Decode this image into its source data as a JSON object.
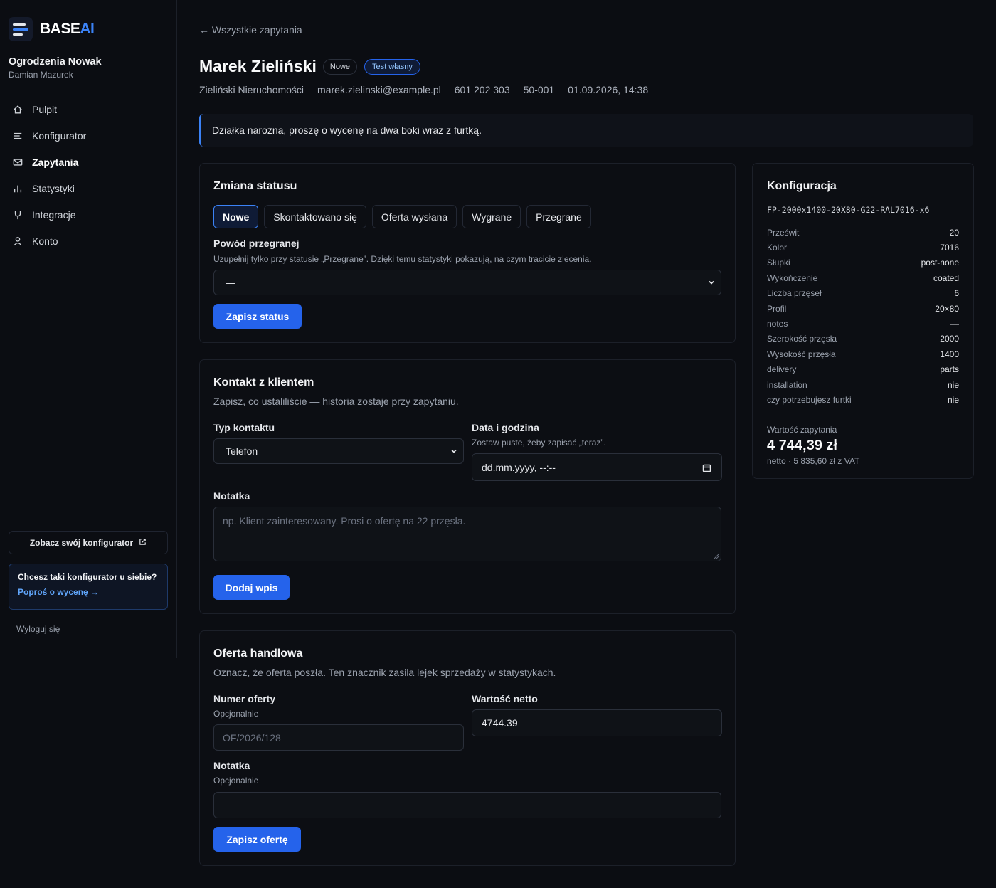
{
  "brand": {
    "name_main": "BASE",
    "name_accent": "AI"
  },
  "company": {
    "name": "Ogrodzenia Nowak",
    "user": "Damian Mazurek"
  },
  "nav": [
    {
      "label": "Pulpit",
      "icon": "home-icon",
      "active": false
    },
    {
      "label": "Konfigurator",
      "icon": "sliders-icon",
      "active": false
    },
    {
      "label": "Zapytania",
      "icon": "mail-icon",
      "active": true
    },
    {
      "label": "Statystyki",
      "icon": "bar-chart-icon",
      "active": false
    },
    {
      "label": "Integracje",
      "icon": "plug-icon",
      "active": false
    },
    {
      "label": "Konto",
      "icon": "user-icon",
      "active": false
    }
  ],
  "sidebar_bottom": {
    "see_config": "Zobacz swój konfigurator",
    "promo_title": "Chcesz taki konfigurator u siebie?",
    "promo_link": "Poproś o wycenę →",
    "logout": "Wyloguj się"
  },
  "header": {
    "back": "← Wszystkie zapytania",
    "name": "Marek Zieliński",
    "badge_status": "Nowe",
    "badge_test": "Test własny",
    "meta": [
      "Zieliński Nieruchomości",
      "marek.zielinski@example.pl",
      "601 202 303",
      "50-001",
      "01.09.2026, 14:38"
    ],
    "message": "Działka narożna, proszę o wycenę na dwa boki wraz z furtką."
  },
  "status_card": {
    "title": "Zmiana statusu",
    "tabs": [
      "Nowe",
      "Skontaktowano się",
      "Oferta wysłana",
      "Wygrane",
      "Przegrane"
    ],
    "active_tab": "Nowe",
    "lost_reason_label": "Powód przegranej",
    "lost_reason_hint": "Uzupełnij tylko przy statusie „Przegrane”. Dzięki temu statystyki pokazują, na czym tracicie zlecenia.",
    "lost_reason_value": "—",
    "save_button": "Zapisz status"
  },
  "contact_card": {
    "title": "Kontakt z klientem",
    "subtitle": "Zapisz, co ustaliliście — historia zostaje przy zapytaniu.",
    "type_label": "Typ kontaktu",
    "type_value": "Telefon",
    "date_label": "Data i godzina",
    "date_hint": "Zostaw puste, żeby zapisać „teraz”.",
    "date_placeholder": "dd.mm.yyyy, --:--",
    "note_label": "Notatka",
    "note_placeholder": "np. Klient zainteresowany. Prosi o ofertę na 22 przęsła.",
    "add_button": "Dodaj wpis"
  },
  "offer_card": {
    "title": "Oferta handlowa",
    "subtitle": "Oznacz, że oferta poszła. Ten znacznik zasila lejek sprzedaży w statystykach.",
    "number_label": "Numer oferty",
    "number_hint": "Opcjonalnie",
    "number_placeholder": "OF/2026/128",
    "value_label": "Wartość netto",
    "value_value": "4744.39",
    "note_label": "Notatka",
    "note_hint": "Opcjonalnie",
    "note_value": "",
    "save_button": "Zapisz ofertę"
  },
  "config_card": {
    "title": "Konfiguracja",
    "code": "FP-2000x1400-20X80-G22-RAL7016-x6",
    "rows": [
      {
        "k": "Prześwit",
        "v": "20"
      },
      {
        "k": "Kolor",
        "v": "7016"
      },
      {
        "k": "Słupki",
        "v": "post-none"
      },
      {
        "k": "Wykończenie",
        "v": "coated"
      },
      {
        "k": "Liczba przęseł",
        "v": "6"
      },
      {
        "k": "Profil",
        "v": "20×80"
      },
      {
        "k": "notes",
        "v": "—"
      },
      {
        "k": "Szerokość przęsła",
        "v": "2000"
      },
      {
        "k": "Wysokość przęsła",
        "v": "1400"
      },
      {
        "k": "delivery",
        "v": "parts"
      },
      {
        "k": "installation",
        "v": "nie"
      },
      {
        "k": "czy potrzebujesz furtki",
        "v": "nie"
      }
    ],
    "value_label": "Wartość zapytania",
    "value_amount": "4 744,39 zł",
    "value_gross": "netto · 5 835,60 zł z VAT"
  },
  "colors": {
    "accent": "#2563eb",
    "background": "#0b0d12",
    "card_border": "#1c2029"
  }
}
